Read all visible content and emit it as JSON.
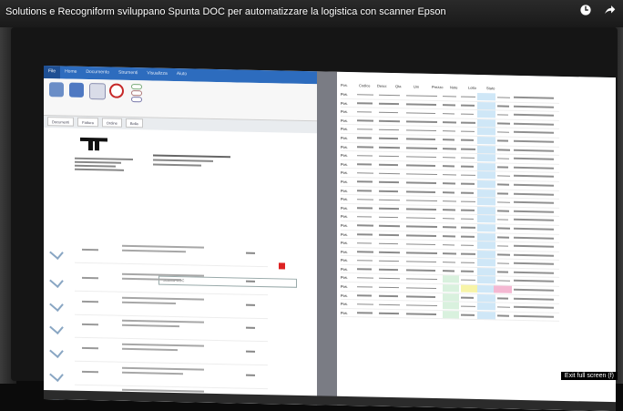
{
  "video": {
    "title": "Solutions e Recogniform sviluppano Spunta DOC per automatizzare la logistica con scanner Epson",
    "overlay_label": "Exit full screen (f)",
    "icons": [
      "clock-icon",
      "share-icon"
    ]
  },
  "app": {
    "ribbon_tabs": [
      "File",
      "Home",
      "Documento",
      "Strumenti",
      "Visualizza",
      "Aiuto"
    ],
    "doc_tabs": [
      "Documenti",
      "Fattura",
      "Ordine",
      "Bolla"
    ],
    "popup_text": "Scarica DOC",
    "accent": "#2d6cbe"
  },
  "grid": {
    "header": [
      "Pos.",
      "Codice",
      "Descr.",
      "Qta",
      "Um",
      "Prezzo",
      "Note",
      "Lotto",
      "Stato"
    ],
    "row_count": 26,
    "position_prefix": "Pos."
  }
}
